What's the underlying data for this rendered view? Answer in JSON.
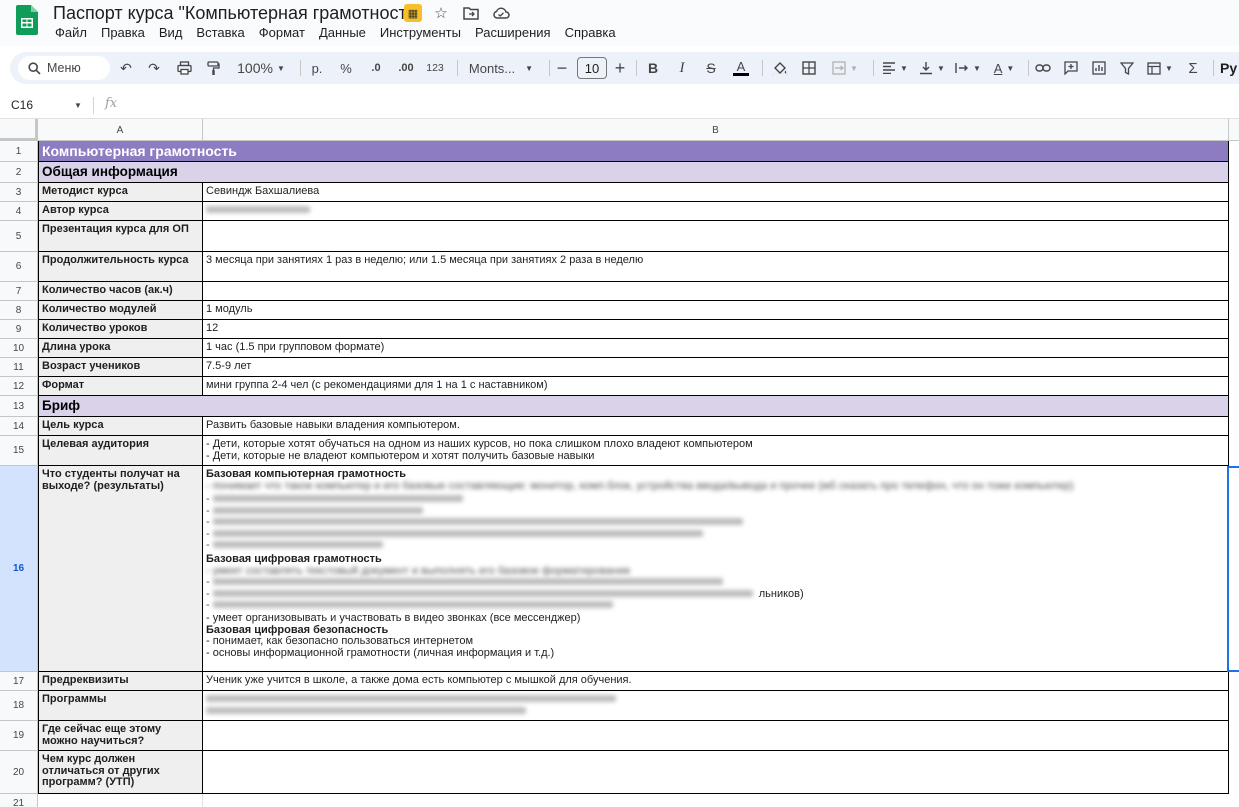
{
  "title": "Паспорт курса \"Компьютерная грамотность\"",
  "menu": [
    "Файл",
    "Правка",
    "Вид",
    "Вставка",
    "Формат",
    "Данные",
    "Инструменты",
    "Расширения",
    "Справка"
  ],
  "toolbar": {
    "search_label": "Меню",
    "zoom": "100%",
    "currency": "р.",
    "percent": "%",
    "dec_decrease": ".0",
    "dec_increase": ".00",
    "number_format": "123",
    "font": "Monts...",
    "font_size": "10",
    "bold": "B",
    "italic": "I",
    "strike": "S",
    "text_color": "A",
    "sigma": "Σ",
    "overflow": "Py"
  },
  "formula_bar": {
    "cell_ref": "C16",
    "fx": "fx"
  },
  "columns": [
    "A",
    "B"
  ],
  "row_numbers": [
    "1",
    "2",
    "3",
    "4",
    "5",
    "6",
    "7",
    "8",
    "9",
    "10",
    "11",
    "12",
    "13",
    "14",
    "15",
    "16",
    "17",
    "18",
    "19",
    "20",
    "21"
  ],
  "sheet": {
    "title": "Компьютерная грамотность",
    "section_general": "Общая информация",
    "section_brief": "Бриф",
    "rows": [
      {
        "label": "Методист курса",
        "value": "Севиндж Бахшалиева"
      },
      {
        "label": "Автор курса",
        "value": ""
      },
      {
        "label": "Презентация курса для ОП",
        "value": ""
      },
      {
        "label": "Продолжительность курса",
        "value": "3 месяца при занятиях 1 раз в неделю; или 1.5 месяца при занятиях 2 раза в неделю"
      },
      {
        "label": "Количество часов (ак.ч)",
        "value": ""
      },
      {
        "label": "Количество модулей",
        "value": "1 модуль"
      },
      {
        "label": "Количество уроков",
        "value": "12"
      },
      {
        "label": "Длина урока",
        "value": "1 час (1.5 при групповом формате)"
      },
      {
        "label": "Возраст учеников",
        "value": "7.5-9 лет"
      },
      {
        "label": "Формат",
        "value": "мини группа 2-4 чел (с рекомендациями для 1 на 1 с наставником)"
      }
    ],
    "brief_rows": [
      {
        "label": "Цель курса",
        "value": "Развить базовые навыки владения компьютером."
      },
      {
        "label": "Целевая аудитория",
        "value": "- Дети, которые хотят обучаться на одном из наших курсов, но пока слишком плохо владеют компьютером\n- Дети, которые не владеют компьютером и хотят получить базовые навыки"
      }
    ],
    "results": {
      "label": "Что студенты получат на выходе? (результаты)",
      "h1": "Базовая компьютерная грамотность",
      "h1_line": "- понимает что такое компьютер и его базовые составляющие: монитор, комп.блок, устройства ввода/вывода и прочее (мб сказать про телефон, что он тоже компьютер)",
      "h2": "Базовая цифровая грамотность",
      "h2_line": "- умеет составлять текстовый документ и выполнять его базовое форматирование",
      "h2_tail": "льников)",
      "h2_last": "- умеет организовывать и участвовать в видео звонках (все мессенджер)",
      "h3": "Базовая цифровая безопасность",
      "h3_l1": "- понимает, как безопасно пользоваться интернетом",
      "h3_l2": "- основы информационной грамотности (личная информация и т.д.)"
    },
    "prereq": {
      "label": "Предреквизиты",
      "value": "Ученик уже учится в школе, а также дома есть компьютер с мышкой для обучения."
    },
    "programs": {
      "label": "Программы",
      "value": ""
    },
    "where": {
      "label": "Где сейчас еще этому можно научиться?",
      "value": ""
    },
    "utp": {
      "label": "Чем курс должен отличаться от других программ? (УТП)",
      "value": ""
    }
  }
}
